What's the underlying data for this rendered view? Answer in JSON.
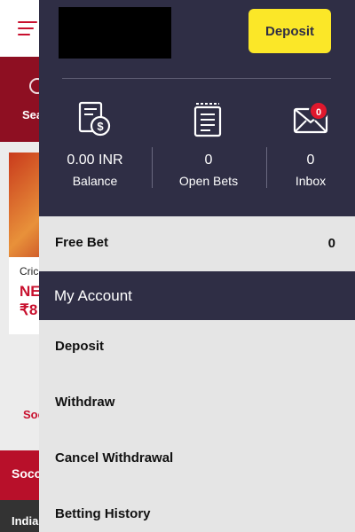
{
  "background": {
    "search_label": "Sea",
    "card_title": "Cric",
    "card_team": "NE",
    "card_price": "₹8",
    "soccer_link": "Soc",
    "soccer_band": "Socc",
    "bottom_label": "India"
  },
  "drawer": {
    "deposit_button": "Deposit",
    "stats": {
      "balance": {
        "value": "0.00 INR",
        "label": "Balance",
        "icon": "wallet-coin-icon"
      },
      "open_bets": {
        "value": "0",
        "label": "Open Bets",
        "icon": "receipt-icon"
      },
      "inbox": {
        "value": "0",
        "label": "Inbox",
        "icon": "envelope-icon",
        "badge": "0"
      }
    },
    "free_bet": {
      "label": "Free Bet",
      "value": "0"
    },
    "section_title": "My Account",
    "menu": [
      {
        "label": "Deposit"
      },
      {
        "label": "Withdraw"
      },
      {
        "label": "Cancel Withdrawal"
      },
      {
        "label": "Betting History"
      }
    ]
  },
  "colors": {
    "header_bg": "#2f2e45",
    "deposit_bg": "#fbe728",
    "badge_bg": "#e0182d",
    "brand_red": "#c8102e",
    "menu_bg": "#e5e5e5"
  }
}
